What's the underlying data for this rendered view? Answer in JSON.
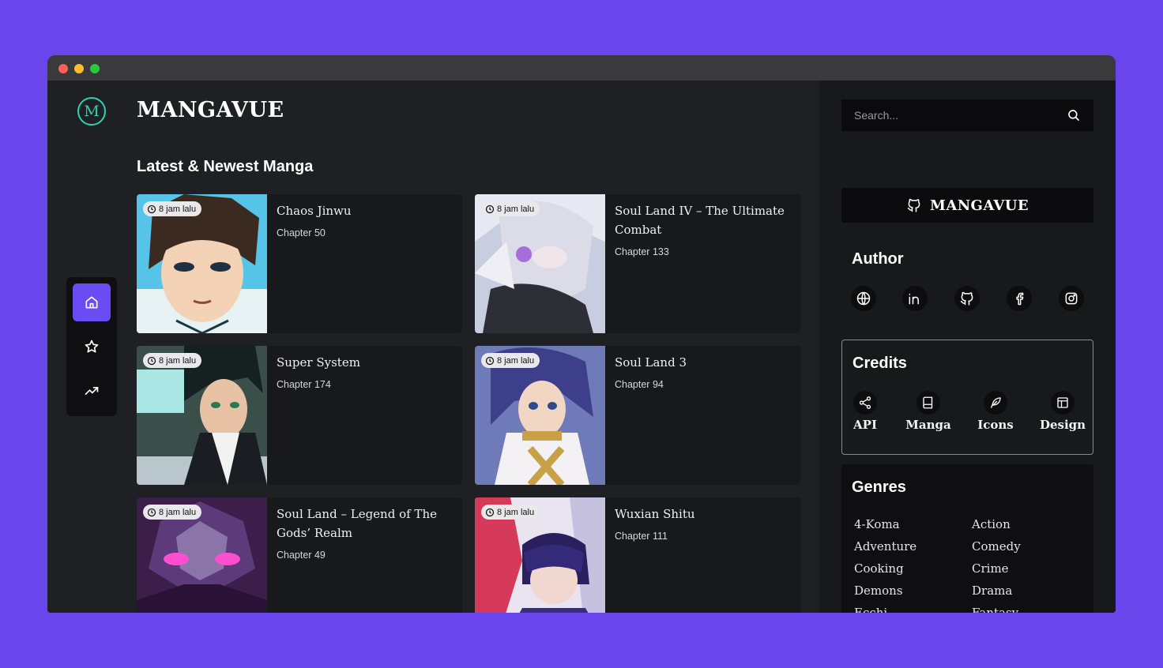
{
  "app": {
    "brand": "MANGAVUE",
    "logo_letter": "M"
  },
  "main": {
    "section_title": "Latest & Newest Manga",
    "manga": [
      {
        "title": "Chaos Jinwu",
        "chapter": "Chapter 50",
        "time": "8 jam lalu"
      },
      {
        "title": "Soul Land IV – The Ultimate Combat",
        "chapter": "Chapter 133",
        "time": "8 jam lalu"
      },
      {
        "title": "Super System",
        "chapter": "Chapter 174",
        "time": "8 jam lalu"
      },
      {
        "title": "Soul Land 3",
        "chapter": "Chapter 94",
        "time": "8 jam lalu"
      },
      {
        "title": "Soul Land – Legend of The Gods’ Realm",
        "chapter": "Chapter 49",
        "time": "8 jam lalu"
      },
      {
        "title": "Wuxian Shitu",
        "chapter": "Chapter 111",
        "time": "8 jam lalu"
      }
    ]
  },
  "nav": {
    "items": [
      "home-icon",
      "star-icon",
      "trending-icon"
    ],
    "active": "home-icon"
  },
  "sidebar": {
    "search_placeholder": "Search...",
    "brand_button": "MANGAVUE",
    "author_title": "Author",
    "socials": [
      "globe-icon",
      "linkedin-icon",
      "github-icon",
      "facebook-icon",
      "instagram-icon"
    ],
    "credits_title": "Credits",
    "credits": [
      "API",
      "Manga",
      "Icons",
      "Design"
    ],
    "genres_title": "Genres",
    "genres": [
      "4-Koma",
      "Action",
      "Adventure",
      "Comedy",
      "Cooking",
      "Crime",
      "Demons",
      "Drama",
      "Ecchi",
      "Fantasy"
    ]
  },
  "colors": {
    "accent": "#6a4cf5",
    "page_bg": "#6846ec",
    "logo": "#2bd4b0"
  }
}
